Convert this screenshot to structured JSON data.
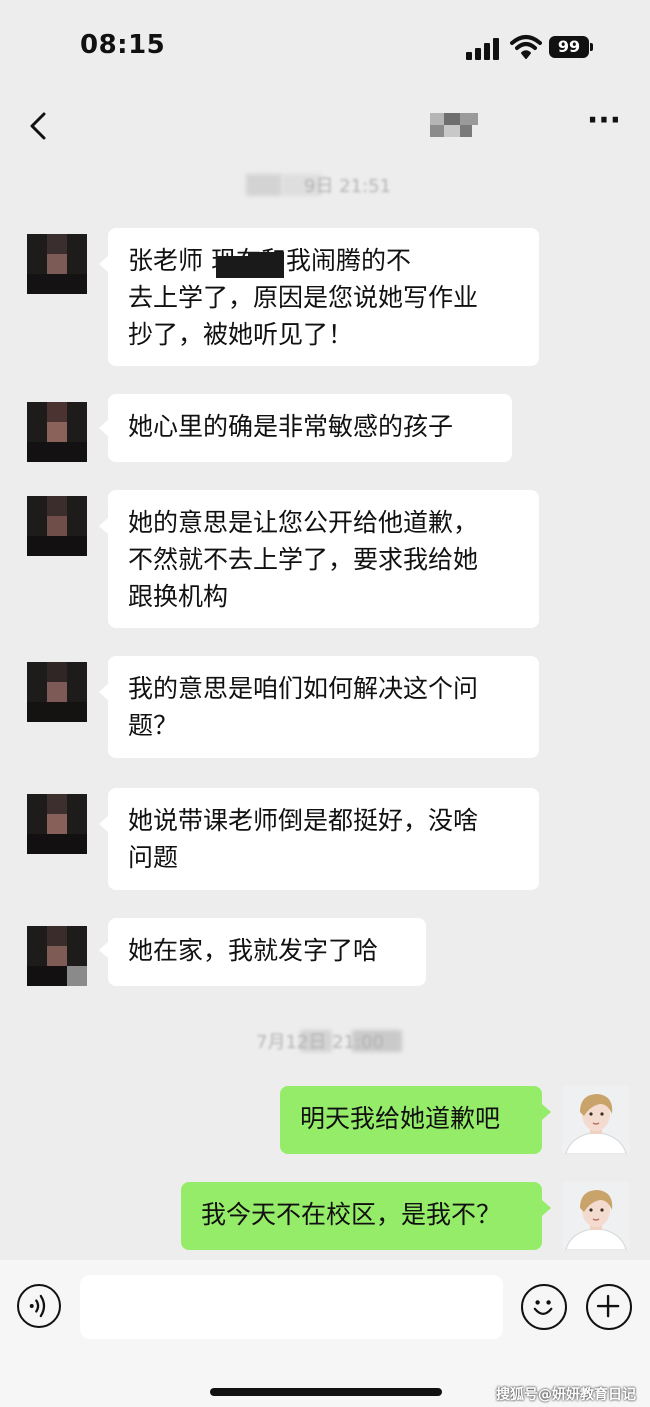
{
  "status_bar": {
    "time": "08:15",
    "battery": "99"
  },
  "nav": {
    "back_icon": "chevron-left-icon",
    "more_icon": "more-horizontal-icon"
  },
  "timestamps": [
    {
      "text": "9日 21:51"
    },
    {
      "text": "7月12日 21:00"
    }
  ],
  "messages": [
    {
      "side": "in",
      "text": "张老师 现在和我闹腾的不\n去上学了，原因是您说她写作业\n抄了，被她听见了！"
    },
    {
      "side": "in",
      "text": "她心里的确是非常敏感的孩子"
    },
    {
      "side": "in",
      "text": "她的意思是让您公开给他道歉，\n不然就不去上学了，要求我给她\n跟换机构"
    },
    {
      "side": "in",
      "text": "我的意思是咱们如何解决这个问\n题？"
    },
    {
      "side": "in",
      "text": "她说带课老师倒是都挺好，没啥\n问题"
    },
    {
      "side": "in",
      "text": "她在家，我就发字了哈"
    },
    {
      "side": "out",
      "text": "明天我给她道歉吧"
    },
    {
      "side": "out",
      "text": "我今天不在校区，是我不？"
    }
  ],
  "input_bar": {
    "voice_icon": "voice-icon",
    "emoji_icon": "emoji-icon",
    "plus_icon": "plus-icon",
    "input_value": ""
  },
  "watermark": "搜狐号@妍妍教育日记",
  "colors": {
    "background": "#ededed",
    "incoming_bubble": "#ffffff",
    "outgoing_bubble": "#95ec69"
  }
}
